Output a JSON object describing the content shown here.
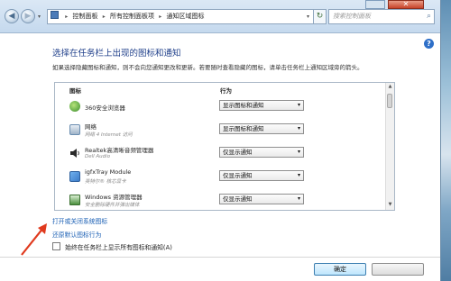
{
  "window": {
    "nav": {
      "back_glyph": "◀",
      "forward_glyph": "▶",
      "dropdown_glyph": "▾"
    },
    "breadcrumbs": [
      "控制面板",
      "所有控制面板项",
      "通知区域图标"
    ],
    "breadcrumb_separator": "▸",
    "search_placeholder": "搜索控制面板",
    "refresh_glyph": "↻",
    "close_glyph": "✕"
  },
  "page": {
    "title": "选择在任务栏上出现的图标和通知",
    "description": "如果选择隐藏图标和通知，则不会向您通知更改和更新。若要随时查看隐藏的图标，请单击任务栏上通知区域旁的箭头。",
    "help_glyph": "?"
  },
  "table": {
    "headers": {
      "icon": "图标",
      "behavior": "行为"
    },
    "rows": [
      {
        "name": "360安全浏览器",
        "sub": "",
        "behavior": "显示图标和通知",
        "icon": "browser-360-icon",
        "icon_color": "#6ab04c"
      },
      {
        "name": "网络",
        "sub": "网络 4 Internet 访问",
        "behavior": "显示图标和通知",
        "icon": "network-icon",
        "icon_color": "#6a8db0"
      },
      {
        "name": "Realtek高清晰音频管理器",
        "sub": "Dell Audio",
        "behavior": "仅显示通知",
        "icon": "speaker-icon",
        "icon_color": "#2a2a2a"
      },
      {
        "name": "igfxTray Module",
        "sub": "英特尔® 核芯显卡",
        "behavior": "仅显示通知",
        "icon": "intel-graphics-icon",
        "icon_color": "#3d7cc9"
      },
      {
        "name": "Windows 资源管理器",
        "sub": "安全删除硬件并弹出媒体",
        "behavior": "仅显示通知",
        "icon": "usb-eject-icon",
        "icon_color": "#4a8f3c"
      }
    ],
    "dropdown_glyph": "▾"
  },
  "links": {
    "system_icons": "打开或关闭系统图标",
    "restore_defaults": "还原默认图标行为"
  },
  "checkbox": {
    "label": "始终在任务栏上显示所有图标和通知(A)",
    "checked": false
  },
  "buttons": {
    "ok": "确定",
    "cancel": ""
  },
  "colors": {
    "title": "#1f3f8a",
    "link": "#1a5fb4",
    "annotation_arrow": "#e03a1e"
  }
}
